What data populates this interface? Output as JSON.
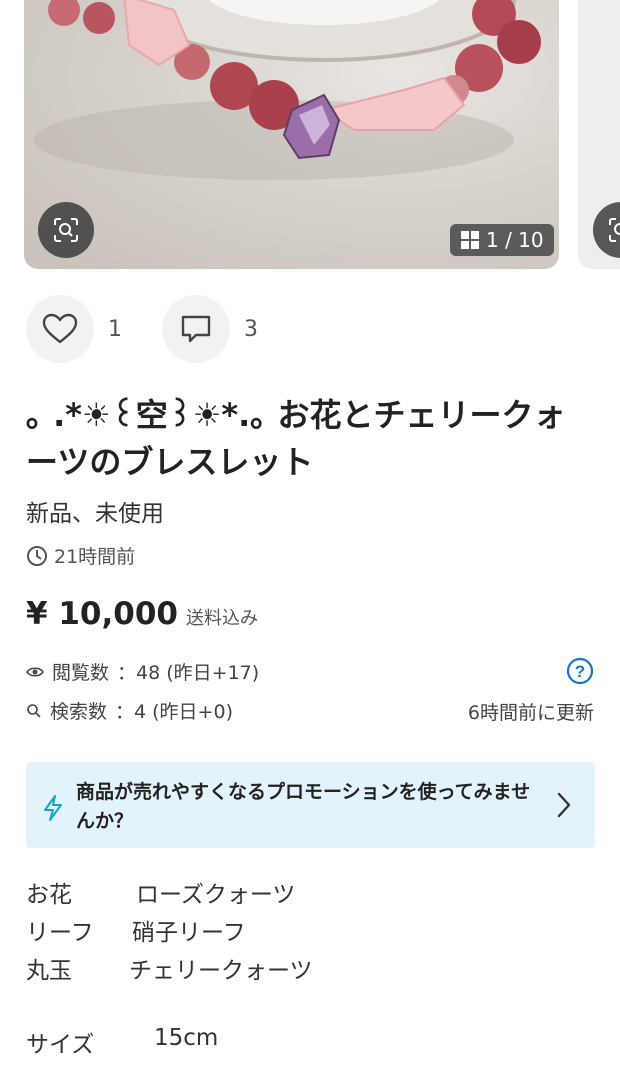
{
  "gallery": {
    "counter": "1 / 10",
    "colors": {
      "background": "#d7d2cc",
      "bead_dark": "#b04650",
      "bead_light": "#e7a8ad",
      "flower": "#f3c4c6"
    }
  },
  "reactions": {
    "likes": "1",
    "comments": "3"
  },
  "item": {
    "title": "｡ .*☀︎꒰空꒱☀︎*.｡ お花とチェリークォーツのブレスレット",
    "condition": "新品、未使用",
    "posted": "21時間前",
    "price": "¥ 10,000",
    "price_note": "送料込み"
  },
  "stats": {
    "views_label": "閲覧数",
    "views_value": "：48 (昨日+17)",
    "search_label": "検索数",
    "search_value": "：4 (昨日+0)",
    "updated": "6時間前に更新"
  },
  "promo": {
    "text": "商品が売れやすくなるプロモーションを使ってみませんか？",
    "color": "#e3f3fb"
  },
  "description": {
    "rows": [
      {
        "key": "お花",
        "value": "ローズクォーツ"
      },
      {
        "key": "リーフ",
        "value": "硝子リーフ"
      },
      {
        "key": "丸玉",
        "value": "チェリークォーツ"
      }
    ],
    "size_key": "サイズ",
    "size_value": "15cm"
  }
}
